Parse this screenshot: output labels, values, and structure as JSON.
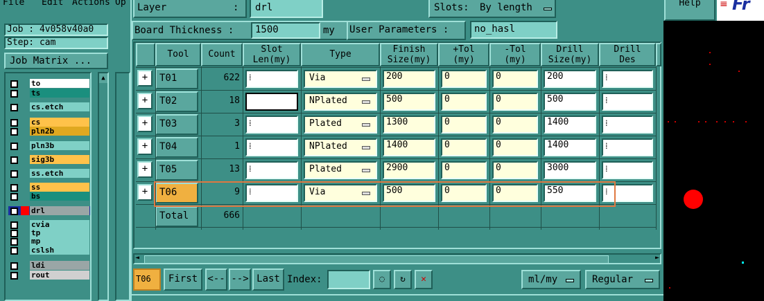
{
  "menubar": {
    "file": "File",
    "edit": "Edit",
    "actions": "Actions",
    "options": "Op"
  },
  "help": "Help",
  "brand": "Fr",
  "left": {
    "job": "Job : 4v058v40a0",
    "step": "Step: cam",
    "job_matrix": "Job Matrix ...",
    "layers": [
      {
        "name": "to",
        "color": "#ffffff"
      },
      {
        "name": "ts",
        "color": "#1a8f7e"
      },
      {
        "name": "cs.etch",
        "color": "#7fd0c6"
      },
      {
        "name": "cs",
        "color": "#ffc24a"
      },
      {
        "name": "pln2b",
        "color": "#e0a820"
      },
      {
        "name": "pln3b",
        "color": "#7fd0c6"
      },
      {
        "name": "sig3b",
        "color": "#ffc24a"
      },
      {
        "name": "ss.etch",
        "color": "#7fd0c6"
      },
      {
        "name": "ss",
        "color": "#ffc24a"
      },
      {
        "name": "bs",
        "color": "#1a8f7e"
      },
      {
        "name": "drl",
        "color": "#9aa6a6"
      },
      {
        "name": "cvia",
        "color": "#7fd0c6"
      },
      {
        "name": "tp",
        "color": "#7fd0c6"
      },
      {
        "name": "mp",
        "color": "#7fd0c6"
      },
      {
        "name": "cslsh",
        "color": "#7fd0c6"
      },
      {
        "name": "ldi",
        "color": "#9aa6a6"
      },
      {
        "name": "rout",
        "color": "#d0d0d0"
      }
    ]
  },
  "top": {
    "layer_label": "Layer",
    "layer_colon": ":",
    "layer_value": "drl",
    "slots_label": "Slots:",
    "slots_value": "By length",
    "thickness_label": "Board Thickness :",
    "thickness_value": "1500",
    "thickness_unit": "my",
    "user_params_label": "User Parameters :",
    "user_params_value": "no_hasl"
  },
  "table": {
    "headers": {
      "tool": "Tool",
      "count": "Count",
      "slot1": "Slot",
      "slot2": "Len(my)",
      "type": "Type",
      "finish1": "Finish",
      "finish2": "Size(my)",
      "ptol1": "+Tol",
      "ptol2": "(my)",
      "mtol1": "-Tol",
      "mtol2": "(my)",
      "drill1": "Drill",
      "drill2": "Size(my)",
      "des1": "Drill",
      "des2": "Des"
    },
    "rows": [
      {
        "tool": "T01",
        "count": "622",
        "type": "Via",
        "finish": "200",
        "ptol": "0",
        "mtol": "0",
        "drill": "200"
      },
      {
        "tool": "T02",
        "count": "18",
        "type": "NPlated",
        "finish": "500",
        "ptol": "0",
        "mtol": "0",
        "drill": "500"
      },
      {
        "tool": "T03",
        "count": "3",
        "type": "Plated",
        "finish": "1300",
        "ptol": "0",
        "mtol": "0",
        "drill": "1400"
      },
      {
        "tool": "T04",
        "count": "1",
        "type": "NPlated",
        "finish": "1400",
        "ptol": "0",
        "mtol": "0",
        "drill": "1400"
      },
      {
        "tool": "T05",
        "count": "13",
        "type": "Plated",
        "finish": "2900",
        "ptol": "0",
        "mtol": "0",
        "drill": "3000"
      },
      {
        "tool": "T06",
        "count": "9",
        "type": "Via",
        "finish": "500",
        "ptol": "0",
        "mtol": "0",
        "drill": "550"
      }
    ],
    "total_label": "Total",
    "total_value": "666"
  },
  "bottom": {
    "current": "T06",
    "first": "First",
    "prev": "<--",
    "next": "-->",
    "last": "Last",
    "index_label": "Index:",
    "units": "ml/my",
    "mode": "Regular"
  },
  "colors": {
    "accent": "#3d8f86",
    "highlight": "#e07840",
    "selected_tool": "#f0b040"
  }
}
